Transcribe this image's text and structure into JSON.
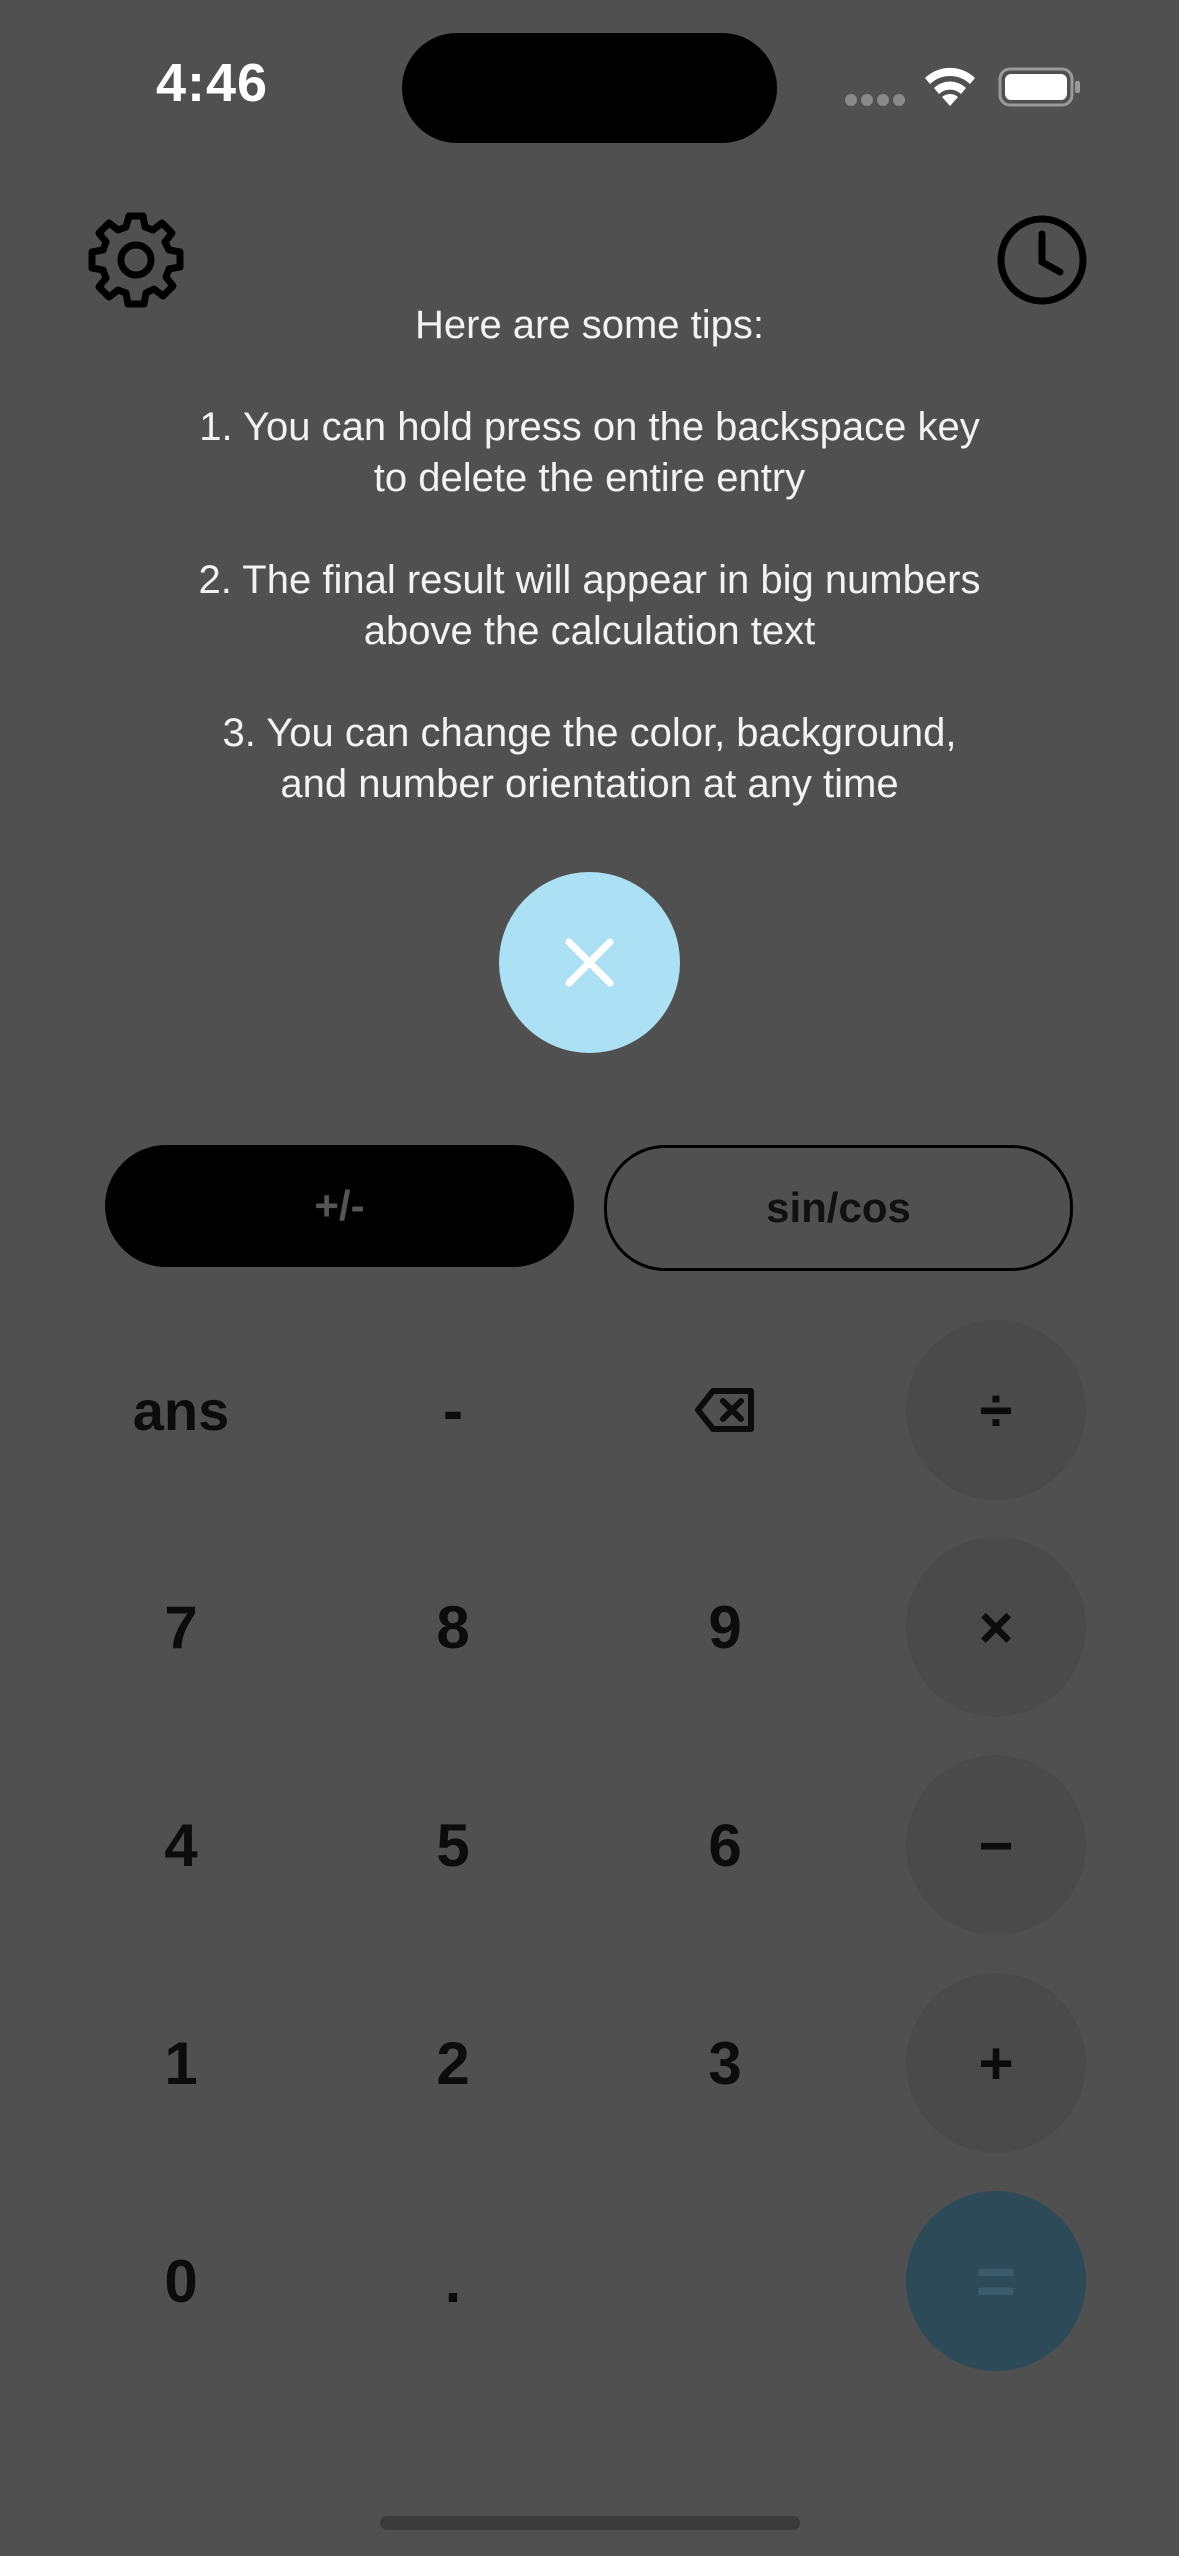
{
  "status_bar": {
    "time": "4:46"
  },
  "toolbar": {
    "settings_icon": "gear-icon",
    "history_icon": "clock-icon"
  },
  "tips": {
    "heading": "Here are some tips:",
    "items": [
      "1. You can hold press on the backspace key\nto delete the entire entry",
      "2. The final result will appear in big numbers\nabove the calculation text",
      "3. You can change the color, background,\nand number orientation at any time"
    ]
  },
  "close_button": {
    "icon": "close-icon",
    "color": "#ace0f5"
  },
  "mode_buttons": {
    "plus_minus": "+/-",
    "sin_cos": "sin/cos"
  },
  "keypad": {
    "row1": [
      "ans",
      "-",
      "backspace",
      "÷"
    ],
    "row2": [
      "7",
      "8",
      "9",
      "×"
    ],
    "row3": [
      "4",
      "5",
      "6",
      "−"
    ],
    "row4": [
      "1",
      "2",
      "3",
      "+"
    ],
    "row5": [
      "0",
      ".",
      "",
      "="
    ]
  },
  "colors": {
    "background": "#505050",
    "operator_key": "#4a4a4a",
    "equals_key": "#2c4a58",
    "accent": "#ace0f5"
  }
}
